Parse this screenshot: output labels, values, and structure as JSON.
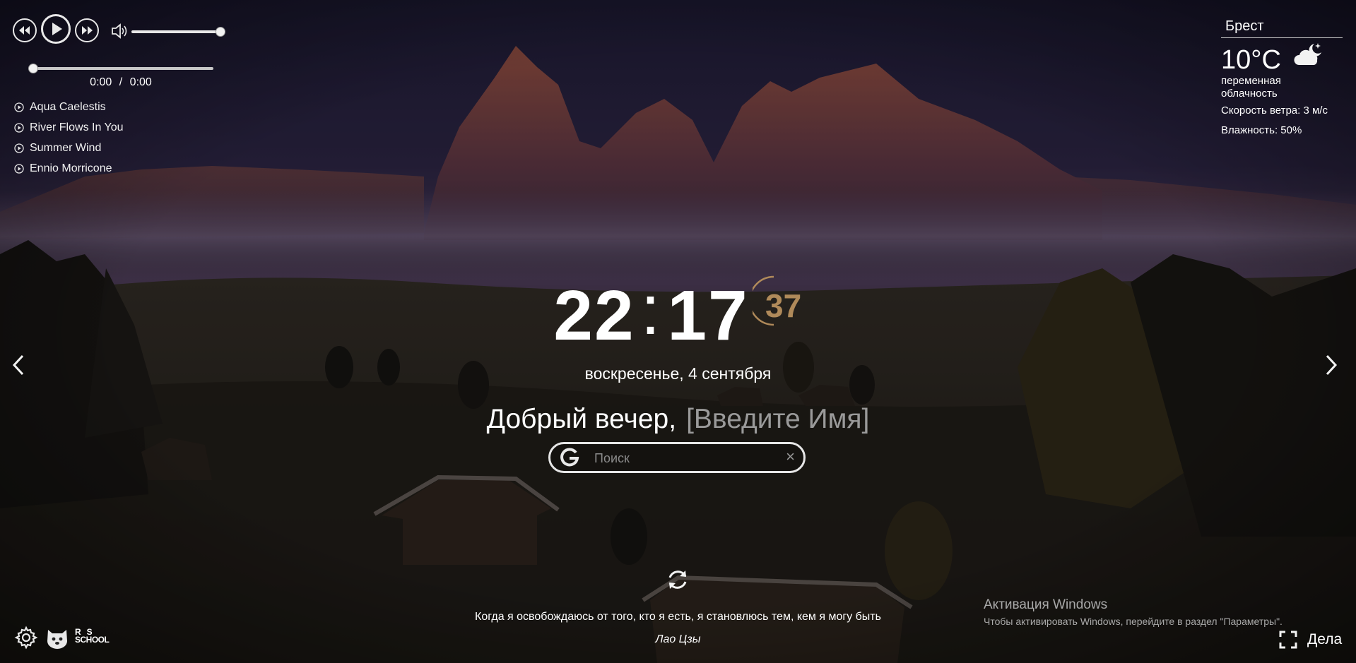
{
  "player": {
    "time_current": "0:00",
    "time_separator": "/",
    "time_total": "0:00",
    "volume_fraction": 1.0,
    "progress_fraction": 0.0,
    "icons": {
      "prev": "rewind-icon",
      "play": "play-icon",
      "next": "fast-forward-icon",
      "volume": "speaker-icon"
    },
    "playlist": [
      {
        "title": "Aqua Caelestis"
      },
      {
        "title": "River Flows In You"
      },
      {
        "title": "Summer Wind"
      },
      {
        "title": "Ennio Morricone"
      }
    ]
  },
  "weather": {
    "city": "Брест",
    "temperature": "10°C",
    "description": "переменная облачность",
    "wind": "Скорость ветра: 3 м/с",
    "humidity": "Влажность: 50%",
    "icon": "partly-cloudy-night-icon"
  },
  "clock": {
    "hours": "22",
    "separator": ":",
    "minutes": "17",
    "seconds": "37"
  },
  "date": "воскресенье, 4 сентября",
  "greeting": {
    "text": "Добрый вечер,",
    "name_placeholder": "[Введите Имя]"
  },
  "search": {
    "placeholder": "Поиск",
    "clear": "×"
  },
  "quote": {
    "text": "Когда я освобождаюсь от того, кто я есть, я становлюсь тем, кем я могу быть",
    "author": "Лао Цзы"
  },
  "activation": {
    "title": "Активация Windows",
    "subtitle": "Чтобы активировать Windows, перейдите в раздел \"Параметры\"."
  },
  "footer": {
    "logo_text_row1": "R   S",
    "logo_text_row2": "SCHOOL",
    "todo_label": "Дела"
  },
  "colors": {
    "accent_seconds": "#b08a5a",
    "text": "#ffffff",
    "muted": "#9a9a9a"
  }
}
